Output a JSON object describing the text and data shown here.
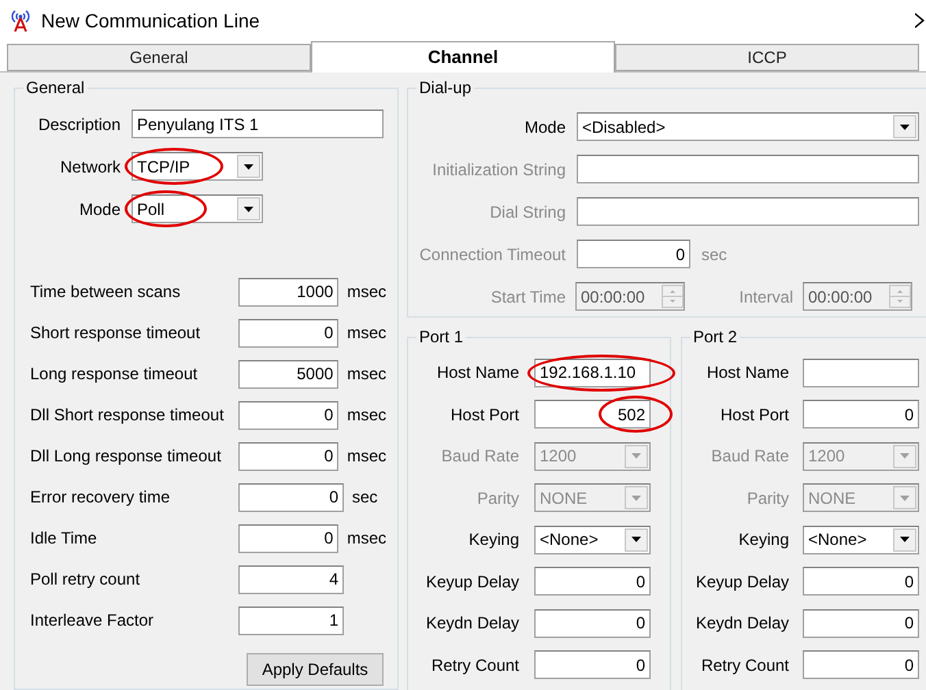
{
  "window": {
    "title": "New Communication Line"
  },
  "tabs": [
    {
      "label": "General",
      "selected": false
    },
    {
      "label": "Channel",
      "selected": true
    },
    {
      "label": "ICCP",
      "selected": false
    }
  ],
  "general": {
    "title": "General",
    "fields": [
      {
        "label": "Description",
        "value": "Penyulang ITS 1",
        "kind": "text",
        "circled": false
      },
      {
        "label": "Network",
        "value": "TCP/IP",
        "kind": "select",
        "circled": true
      },
      {
        "label": "Mode",
        "value": "Poll",
        "kind": "select",
        "circled": true
      }
    ],
    "timings": [
      {
        "label": "Time between scans",
        "value": "1000",
        "unit": "msec"
      },
      {
        "label": "Short response timeout",
        "value": "0",
        "unit": "msec"
      },
      {
        "label": "Long response timeout",
        "value": "5000",
        "unit": "msec"
      },
      {
        "label": "Dll Short response timeout",
        "value": "0",
        "unit": "msec"
      },
      {
        "label": "Dll Long response timeout",
        "value": "0",
        "unit": "msec"
      },
      {
        "label": "Error recovery time",
        "value": "0",
        "unit": "sec"
      },
      {
        "label": "Idle Time",
        "value": "0",
        "unit": "msec"
      },
      {
        "label": "Poll retry count",
        "value": "4"
      },
      {
        "label": "Interleave Factor",
        "value": "1"
      }
    ],
    "button": "Apply Defaults"
  },
  "dialup": {
    "title": "Dial-up",
    "fields": [
      {
        "label": "Mode",
        "value": "<Disabled>",
        "kind": "select",
        "disabled": false
      },
      {
        "label": "Initialization String",
        "kind": "text",
        "disabled": true
      },
      {
        "label": "Dial String",
        "kind": "text",
        "disabled": true
      },
      {
        "label": "Connection Timeout",
        "value": "0",
        "unit": "sec",
        "kind": "number",
        "disabled": true
      }
    ],
    "times": [
      {
        "label": "Start Time",
        "value": "00:00:00",
        "disabled": true
      },
      {
        "label": "Interval",
        "value": "00:00:00",
        "disabled": true
      }
    ]
  },
  "ports": [
    {
      "title": "Port 1",
      "rows": [
        {
          "label": "Host Name",
          "value": "192.168.1.10",
          "kind": "text",
          "disabled": false,
          "circled": true
        },
        {
          "label": "Host Port",
          "value": "502",
          "kind": "number",
          "disabled": false,
          "circled": true
        },
        {
          "label": "Baud Rate",
          "value": "1200",
          "kind": "select",
          "disabled": true,
          "circled": false
        },
        {
          "label": "Parity",
          "value": "NONE",
          "kind": "select",
          "disabled": true,
          "circled": false
        },
        {
          "label": "Keying",
          "value": "<None>",
          "kind": "select",
          "disabled": false,
          "circled": false
        },
        {
          "label": "Keyup Delay",
          "value": "0",
          "kind": "number",
          "disabled": false,
          "circled": false
        },
        {
          "label": "Keydn Delay",
          "value": "0",
          "kind": "number",
          "disabled": false,
          "circled": false
        },
        {
          "label": "Retry Count",
          "value": "0",
          "kind": "number",
          "disabled": false,
          "circled": false
        }
      ]
    },
    {
      "title": "Port 2",
      "rows": [
        {
          "label": "Host Name",
          "kind": "text",
          "disabled": false,
          "circled": false
        },
        {
          "label": "Host Port",
          "value": "0",
          "kind": "number",
          "disabled": false,
          "circled": false
        },
        {
          "label": "Baud Rate",
          "value": "1200",
          "kind": "select",
          "disabled": true,
          "circled": false
        },
        {
          "label": "Parity",
          "value": "NONE",
          "kind": "select",
          "disabled": true,
          "circled": false
        },
        {
          "label": "Keying",
          "value": "<None>",
          "kind": "select",
          "disabled": false,
          "circled": false
        },
        {
          "label": "Keyup Delay",
          "value": "0",
          "kind": "number",
          "disabled": false,
          "circled": false
        },
        {
          "label": "Keydn Delay",
          "value": "0",
          "kind": "number",
          "disabled": false,
          "circled": false
        },
        {
          "label": "Retry Count",
          "value": "0",
          "kind": "number",
          "disabled": false,
          "circled": false
        }
      ]
    }
  ]
}
